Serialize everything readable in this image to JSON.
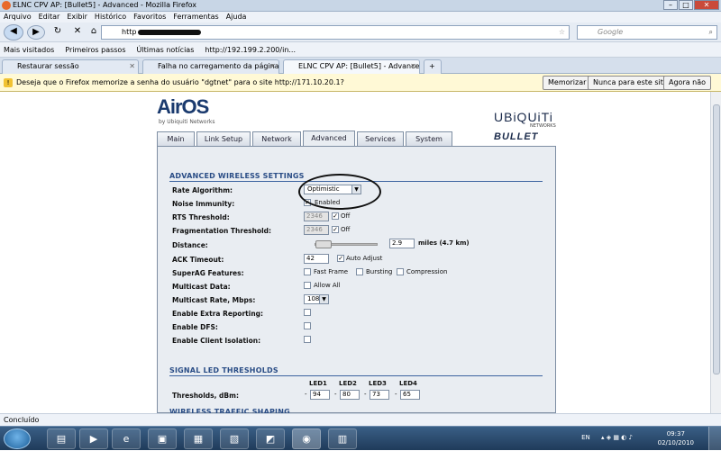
{
  "window": {
    "title": "ELNC CPV AP: [Bullet5] - Advanced - Mozilla Firefox"
  },
  "menu": [
    "Arquivo",
    "Editar",
    "Exibir",
    "Histórico",
    "Favoritos",
    "Ferramentas",
    "Ajuda"
  ],
  "nav": {
    "url": "http",
    "search_placeholder": "Google"
  },
  "bookmarks": [
    "Mais visitados",
    "Primeiros passos",
    "Últimas notícias",
    "http://192.199.2.200/in..."
  ],
  "tabs": [
    {
      "label": "Restaurar sessão"
    },
    {
      "label": "Falha no carregamento da página"
    },
    {
      "label": "ELNC CPV AP: [Bullet5] - Advanced"
    }
  ],
  "notification": {
    "text": "Deseja que o Firefox memorize a senha do usuário \"dgtnet\" para o site http://171.10.20.1?",
    "buttons": [
      "Memorizar",
      "Nunca para este site",
      "Agora não"
    ]
  },
  "brand": {
    "airos": "AirOS",
    "airos_sub": "by Ubiquiti Networks",
    "ubnt": "UBiQUiTi",
    "ubnt_sub": "NETWORKS",
    "bullet": "BULLET"
  },
  "page_tabs": [
    "Main",
    "Link Setup",
    "Network",
    "Advanced",
    "Services",
    "System"
  ],
  "advanced": {
    "section_title": "ADVANCED WIRELESS SETTINGS",
    "rate_algorithm": {
      "label": "Rate Algorithm:",
      "value": "Optimistic"
    },
    "noise_immunity": {
      "label": "Noise Immunity:",
      "checkbox": "Enabled",
      "checked": true
    },
    "rts": {
      "label": "RTS Threshold:",
      "value": "2346",
      "off_label": "Off",
      "off_checked": true
    },
    "frag": {
      "label": "Fragmentation Threshold:",
      "value": "2346",
      "off_label": "Off",
      "off_checked": true
    },
    "distance": {
      "label": "Distance:",
      "value": "2.9",
      "unit": "miles (4.7 km)",
      "slider_fraction": 0.02
    },
    "ack": {
      "label": "ACK Timeout:",
      "value": "42",
      "auto_label": "Auto Adjust",
      "auto_checked": true
    },
    "superag": {
      "label": "SuperAG Features:",
      "options": [
        "Fast Frame",
        "Bursting",
        "Compression"
      ]
    },
    "multicast_data": {
      "label": "Multicast Data:",
      "checkbox": "Allow All"
    },
    "multicast_rate": {
      "label": "Multicast Rate, Mbps:",
      "value": "108"
    },
    "extra_reporting": {
      "label": "Enable Extra Reporting:"
    },
    "dfs": {
      "label": "Enable DFS:"
    },
    "client_isolation": {
      "label": "Enable Client Isolation:"
    }
  },
  "led": {
    "section_title": "SIGNAL LED THRESHOLDS",
    "row_label": "Thresholds, dBm:",
    "headers": [
      "LED1",
      "LED2",
      "LED3",
      "LED4"
    ],
    "values": [
      "94",
      "80",
      "73",
      "65"
    ],
    "sign": "-"
  },
  "traffic_section": "WIRELESS TRAFFIC SHAPING",
  "status": "Concluído",
  "taskbar": {
    "lang": "EN",
    "time": "09:37",
    "date": "02/10/2010"
  }
}
